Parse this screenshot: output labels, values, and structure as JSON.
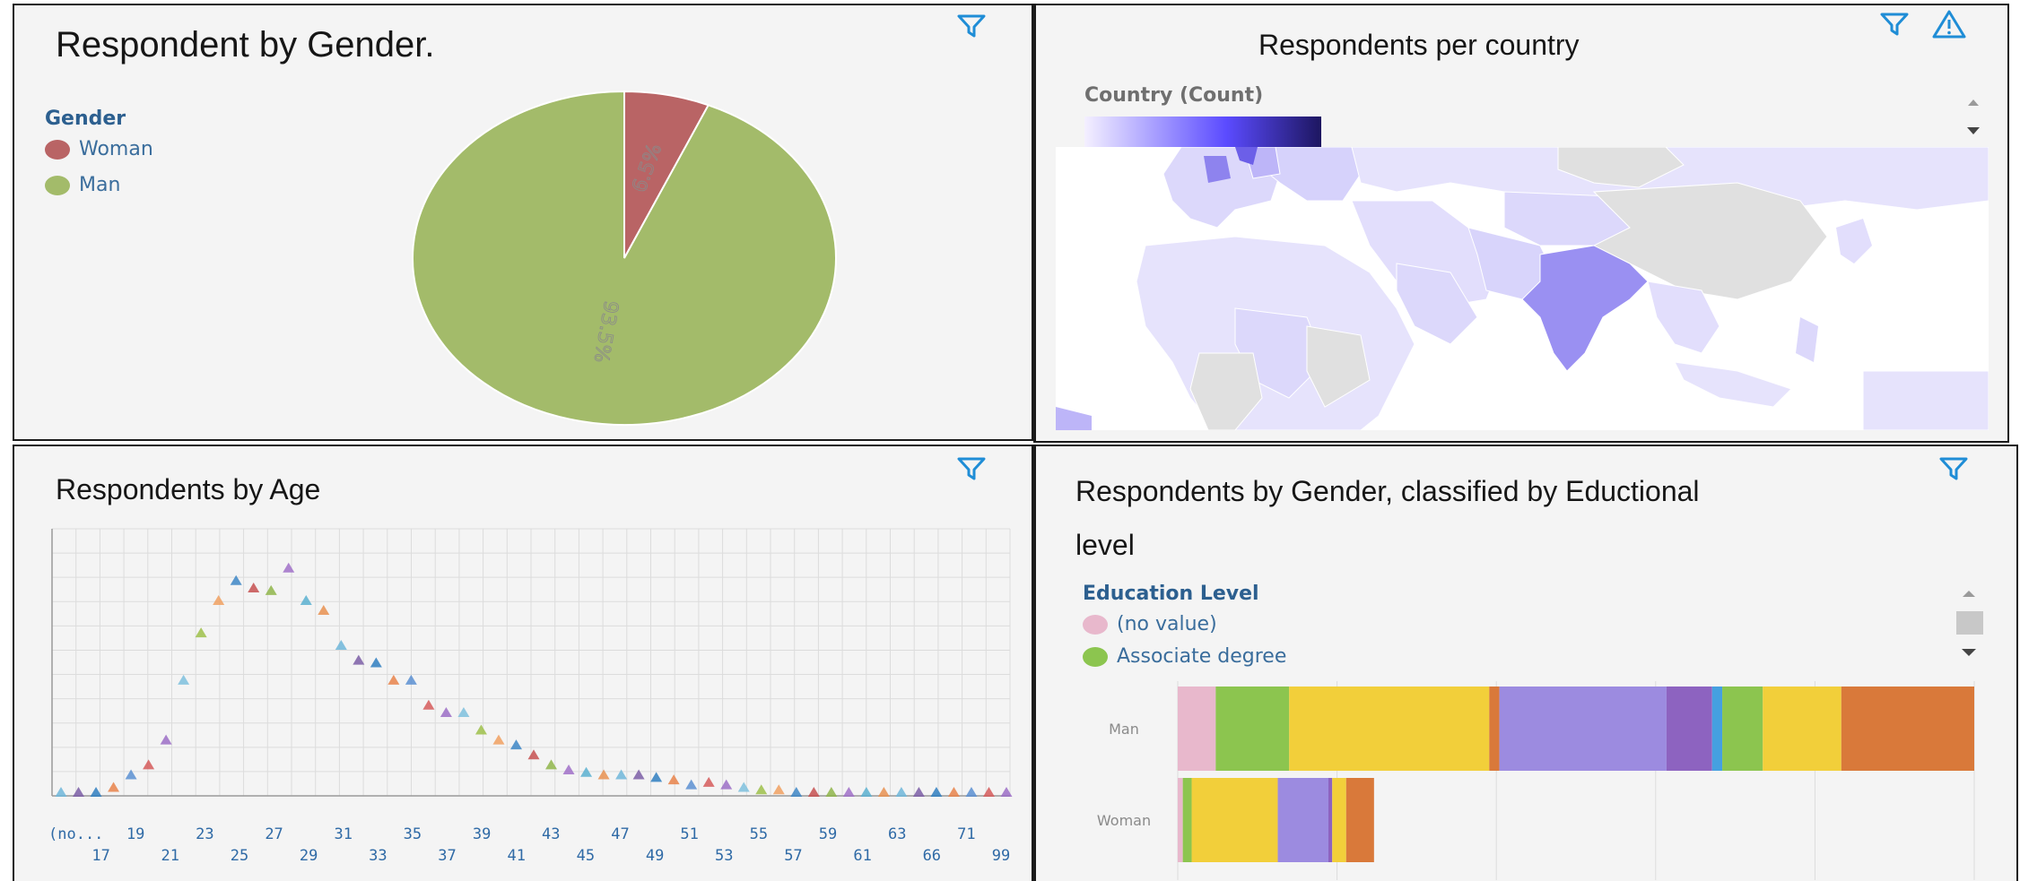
{
  "panels": {
    "gender": {
      "title": "Respondent by Gender.",
      "legend_title": "Gender",
      "legend": [
        "Woman",
        "Man"
      ]
    },
    "country": {
      "title": "Respondents per country",
      "legend_title": "Country (Count)"
    },
    "age": {
      "title": "Respondents by Age"
    },
    "education": {
      "title_line1": "Respondents by Gender, classified by Eductional",
      "title_line2": "level",
      "legend_title": "Education Level",
      "legend": [
        "(no value)",
        "Associate degree"
      ]
    }
  },
  "colors": {
    "woman": "#b96465",
    "man": "#a3bb6a",
    "icon": "#1f8dd6",
    "tick": "#2f6aa6"
  },
  "chart_data": [
    {
      "type": "pie",
      "title": "Respondent by Gender.",
      "slices": [
        {
          "label": "Woman",
          "value": 6.5,
          "display": "6.5%"
        },
        {
          "label": "Man",
          "value": 93.5,
          "display": "93.5%"
        }
      ]
    },
    {
      "type": "scatter",
      "title": "Respondents by Age",
      "x_tick_labels_upper": [
        "(no...",
        "19",
        "23",
        "27",
        "31",
        "35",
        "39",
        "43",
        "47",
        "51",
        "55",
        "59",
        "63",
        "71"
      ],
      "x_tick_labels_lower": [
        "17",
        "21",
        "25",
        "29",
        "33",
        "37",
        "41",
        "45",
        "49",
        "53",
        "57",
        "61",
        "66",
        "99"
      ],
      "values": [
        0.0,
        0.0,
        0.0,
        0.02,
        0.07,
        0.11,
        0.21,
        0.45,
        0.64,
        0.77,
        0.85,
        0.82,
        0.81,
        0.9,
        0.77,
        0.73,
        0.59,
        0.53,
        0.52,
        0.45,
        0.45,
        0.35,
        0.32,
        0.32,
        0.25,
        0.21,
        0.19,
        0.15,
        0.11,
        0.09,
        0.08,
        0.07,
        0.07,
        0.07,
        0.06,
        0.05,
        0.03,
        0.04,
        0.03,
        0.02,
        0.01,
        0.01,
        0.0,
        0.0,
        0.0,
        0.0,
        0.0,
        0.0,
        0.0,
        0.0,
        0.0,
        0.0,
        0.0,
        0.0,
        0.0
      ],
      "point_colors": [
        "#6fb6d9",
        "#7b5ea6",
        "#2f7ec0",
        "#e8824a",
        "#5b8fd1",
        "#d55a5a",
        "#9b6dc6",
        "#7ec0dd",
        "#9dbf4a",
        "#f0a060",
        "#3d86c6",
        "#c65050",
        "#8fb54a",
        "#a070c8",
        "#5ab0d0",
        "#e89050"
      ],
      "grid": true
    },
    {
      "type": "bar",
      "title": "Respondents by Gender, classified by Eductional level",
      "categories": [
        "Man",
        "Woman"
      ],
      "segments": [
        [
          {
            "color": "#e8b8cc",
            "value": 30
          },
          {
            "color": "#8cc54f",
            "value": 58
          },
          {
            "color": "#f2cf3a",
            "value": 158
          },
          {
            "color": "#d9793a",
            "value": 8
          },
          {
            "color": "#9c8be0",
            "value": 132
          },
          {
            "color": "#8d63c0",
            "value": 36
          },
          {
            "color": "#45a0e0",
            "value": 8
          },
          {
            "color": "#8cc54f",
            "value": 32
          },
          {
            "color": "#f2cf3a",
            "value": 62
          },
          {
            "color": "#d9793a",
            "value": 105
          }
        ],
        [
          {
            "color": "#e8b8cc",
            "value": 4
          },
          {
            "color": "#8cc54f",
            "value": 7
          },
          {
            "color": "#f2cf3a",
            "value": 68
          },
          {
            "color": "#9c8be0",
            "value": 40
          },
          {
            "color": "#8d63c0",
            "value": 3
          },
          {
            "color": "#f2cf3a",
            "value": 11
          },
          {
            "color": "#d9793a",
            "value": 22
          }
        ]
      ],
      "grid": true
    }
  ]
}
